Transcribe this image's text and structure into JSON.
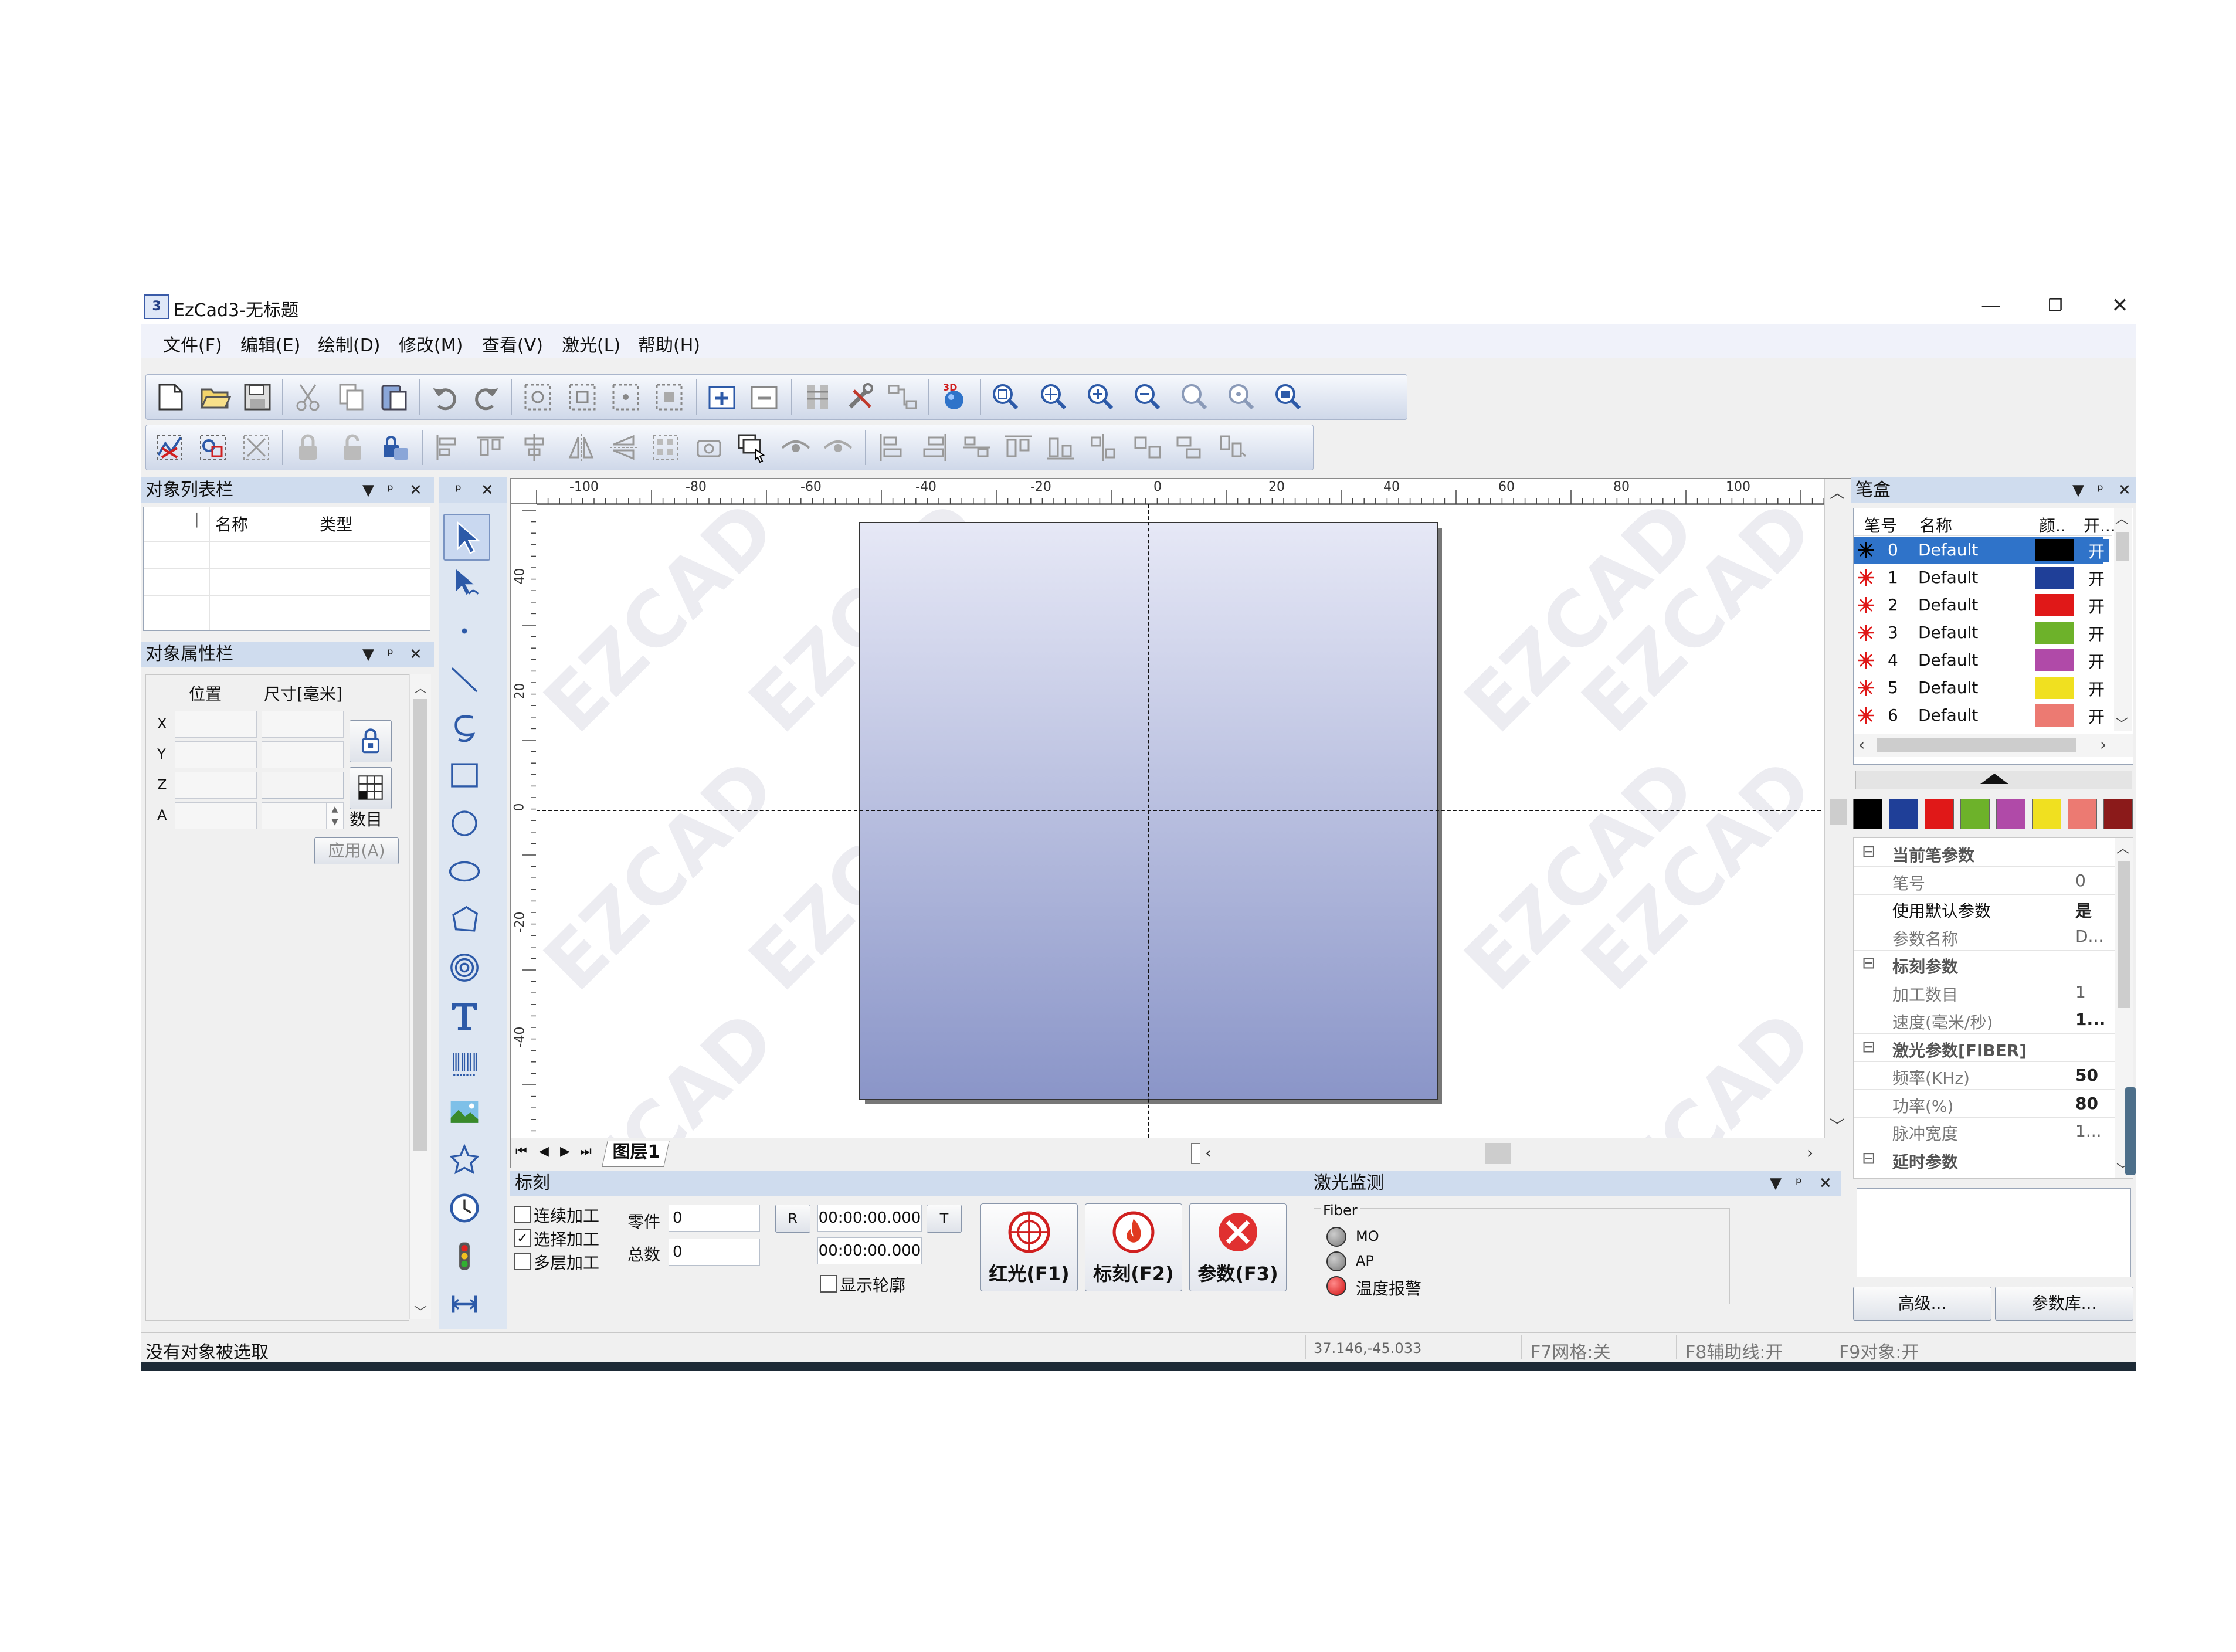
{
  "window": {
    "title": "EzCad3-无标题",
    "logo_text": "3",
    "minimize": "—",
    "restore": "❐",
    "close": "✕"
  },
  "menu": [
    "文件(F)",
    "编辑(E)",
    "绘制(D)",
    "修改(M)",
    "查看(V)",
    "激光(L)",
    "帮助(H)"
  ],
  "toolbar": {
    "icon_3d_label": "3D"
  },
  "object_list": {
    "title": "对象列表栏",
    "columns": [
      "名称",
      "类型"
    ],
    "col_marker": "∣"
  },
  "object_props": {
    "title": "对象属性栏",
    "headers": [
      "位置",
      "尺寸[毫米]"
    ],
    "rows": [
      "X",
      "Y",
      "Z",
      "A"
    ],
    "count_label": "数目",
    "apply_label": "应用(A)"
  },
  "panel_controls": {
    "dropdown": "▼",
    "pin": "ᵖ",
    "close": "✕"
  },
  "canvas": {
    "ruler_x": [
      "-100",
      "-80",
      "-60",
      "-40",
      "-20",
      "0",
      "20",
      "40",
      "60",
      "80",
      "100"
    ],
    "ruler_y": [
      "40",
      "20",
      "0",
      "-20",
      "-40"
    ],
    "watermark": "EZCAD",
    "layer_tab": "图层1",
    "nav": [
      "⏮",
      "◀",
      "▶",
      "⏭"
    ]
  },
  "pen_box": {
    "title": "笔盒",
    "columns": [
      "笔号",
      "名称",
      "颜..",
      "开..."
    ],
    "pens": [
      {
        "no": "0",
        "name": "Default",
        "color": "#000000",
        "state": "开"
      },
      {
        "no": "1",
        "name": "Default",
        "color": "#1f3f98",
        "state": "开"
      },
      {
        "no": "2",
        "name": "Default",
        "color": "#e01818",
        "state": "开"
      },
      {
        "no": "3",
        "name": "Default",
        "color": "#6db22a",
        "state": "开"
      },
      {
        "no": "4",
        "name": "Default",
        "color": "#b04aa8",
        "state": "开"
      },
      {
        "no": "5",
        "name": "Default",
        "color": "#f0e020",
        "state": "开"
      },
      {
        "no": "6",
        "name": "Default",
        "color": "#ec7a72",
        "state": "开"
      }
    ],
    "palette": [
      "#000000",
      "#1f3f98",
      "#e01818",
      "#6db22a",
      "#b04aa8",
      "#f0e020",
      "#ec7a72",
      "#8b1a1a"
    ],
    "props": [
      {
        "type": "group",
        "label": "当前笔参数",
        "toggle": "⊟"
      },
      {
        "type": "item",
        "label": "笔号",
        "value": "0"
      },
      {
        "type": "item",
        "label": "使用默认参数",
        "value": "是",
        "strong": true
      },
      {
        "type": "item",
        "label": "参数名称",
        "value": "D..."
      },
      {
        "type": "group",
        "label": "标刻参数",
        "toggle": "⊟"
      },
      {
        "type": "item",
        "label": "加工数目",
        "value": "1"
      },
      {
        "type": "item",
        "label": "速度(毫米/秒)",
        "value": "1...",
        "bold": true
      },
      {
        "type": "group",
        "label": "激光参数[FIBER]",
        "toggle": "⊟"
      },
      {
        "type": "item",
        "label": "频率(KHz)",
        "value": "50",
        "bold": true
      },
      {
        "type": "item",
        "label": "功率(%)",
        "value": "80",
        "bold": true
      },
      {
        "type": "item",
        "label": "脉冲宽度",
        "value": "1..."
      },
      {
        "type": "group",
        "label": "延时参数",
        "toggle": "⊟"
      }
    ],
    "advanced_btn": "高级...",
    "library_btn": "参数库..."
  },
  "mark_panel": {
    "title": "标刻",
    "checks": [
      {
        "label": "连续加工",
        "checked": false
      },
      {
        "label": "选择加工",
        "checked": true
      },
      {
        "label": "多层加工",
        "checked": false
      }
    ],
    "part_label": "零件",
    "part_value": "0",
    "total_label": "总数",
    "total_value": "0",
    "r_btn": "R",
    "t_btn": "T",
    "time1": "00:00:00.000",
    "time2": "00:00:00.000",
    "show_contour": "显示轮廓",
    "btn_red": "红光(F1)",
    "btn_mark": "标刻(F2)",
    "btn_param": "参数(F3)"
  },
  "laser_monitor": {
    "title": "激光监测",
    "group": "Fiber",
    "items": [
      {
        "label": "MO",
        "color": "#7a7a7a"
      },
      {
        "label": "AP",
        "color": "#7a7a7a"
      },
      {
        "label": "温度报警",
        "color": "#d01010"
      }
    ]
  },
  "status": {
    "message": "没有对象被选取",
    "coords": "37.146,-45.033",
    "grid": "F7网格:关",
    "guide": "F8辅助线:开",
    "object": "F9对象:开"
  },
  "colors": {
    "accent": "#2f73c9",
    "panel_title": "#cfdcee",
    "rect_top": "#e6e8f6",
    "rect_bottom": "#8a95c8"
  }
}
